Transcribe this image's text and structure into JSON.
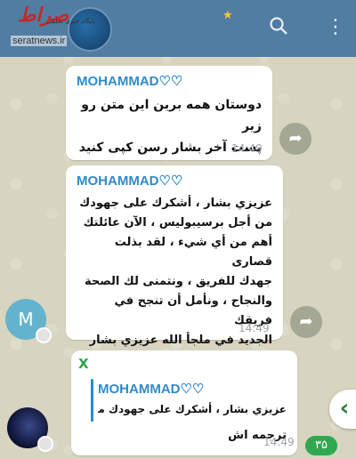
{
  "header": {
    "title": "",
    "subtitle": "",
    "more_icon": "more-vert-icon",
    "search_icon": "search-icon"
  },
  "watermark": {
    "logo_text": "صراط",
    "tagline": "پایگاه خبری تحلیلی",
    "url": "seratnews.ir"
  },
  "messages": [
    {
      "sender": "MOHAMMAD♡♡",
      "lines": [
        "دوستان همه برین این متن رو زیر",
        "پست آخر بشار رسن کپی کنید"
      ],
      "time": "14:49"
    },
    {
      "sender": "MOHAMMAD♡♡",
      "lines": [
        "عزيزي بشار ، أشكرك على جهودك",
        "من أجل برسيبوليس ، الآن عائلتك",
        "أهم من أي شيء ، لقد بذلت قصارى",
        "جهدك للفريق ، ونتمنى لك الصحة",
        "والنجاح ، ونأمل أن تنجح في فريقك",
        "الجديد في ملجأ الله عزيزي بشار"
      ],
      "time": "14:49",
      "avatar_letter": "M"
    },
    {
      "sender": "X",
      "reply_to": "MOHAMMAD♡♡",
      "reply_preview": "عزيزي بشار ، أشكرك على جهودك من أج...",
      "text": "ترجمه اش",
      "time": "14:49"
    }
  ],
  "unread_badge": "۳۵",
  "colors": {
    "header": "#517da2",
    "sender_blue": "#2f8bc9",
    "reply_green": "#2aa54a",
    "badge_green": "#2fa84f"
  }
}
